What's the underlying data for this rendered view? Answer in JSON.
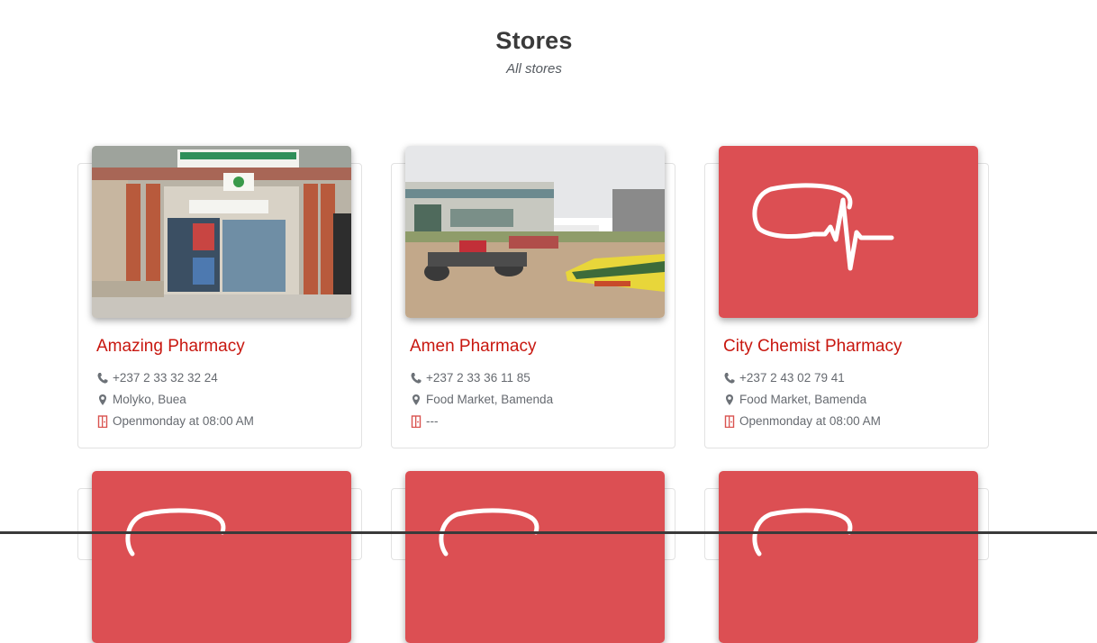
{
  "header": {
    "title": "Stores",
    "subtitle": "All stores"
  },
  "stores": [
    {
      "name": "Amazing Pharmacy",
      "phone": "+237 2 33 32 32 24",
      "address": "Molyko, Buea",
      "hours": "Openmonday at 08:00 AM",
      "image": "storefront-photo"
    },
    {
      "name": "Amen Pharmacy",
      "phone": "+237 2 33 36 11 85",
      "address": "Food Market, Bamenda",
      "hours": "---",
      "image": "street-photo"
    },
    {
      "name": "City Chemist Pharmacy",
      "phone": "+237 2 43 02 79 41",
      "address": "Food Market, Bamenda",
      "hours": "Openmonday at 08:00 AM",
      "image": "heartbeat-logo"
    }
  ],
  "icons": {
    "phone": "phone-icon",
    "address": "map-pin-icon",
    "hours": "door-open-icon"
  },
  "colors": {
    "store_name": "#c8170f",
    "placeholder_bg": "#dc4f53",
    "hours_icon": "#d9534f"
  }
}
